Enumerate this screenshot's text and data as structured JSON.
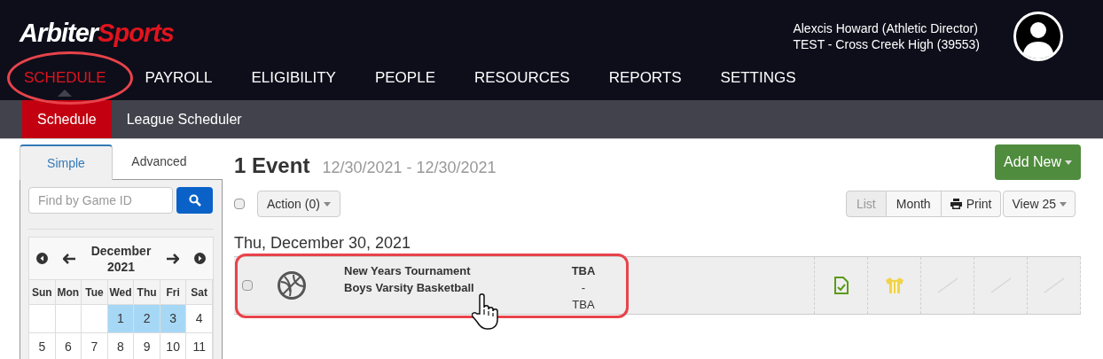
{
  "logo": {
    "first": "Arbiter",
    "second": "Sports"
  },
  "user": {
    "name": "Alexcis Howard (Athletic Director)",
    "org": "TEST - Cross Creek High (39553)"
  },
  "nav": [
    {
      "label": "SCHEDULE",
      "selected": true
    },
    {
      "label": "PAYROLL",
      "selected": false
    },
    {
      "label": "ELIGIBILITY",
      "selected": false
    },
    {
      "label": "PEOPLE",
      "selected": false
    },
    {
      "label": "RESOURCES",
      "selected": false
    },
    {
      "label": "REPORTS",
      "selected": false
    },
    {
      "label": "SETTINGS",
      "selected": false
    }
  ],
  "subnav": [
    {
      "label": "Schedule",
      "selected": true
    },
    {
      "label": "League Scheduler",
      "selected": false
    }
  ],
  "sidebar": {
    "tabs": [
      {
        "label": "Simple",
        "selected": true
      },
      {
        "label": "Advanced",
        "selected": false
      }
    ],
    "search": {
      "placeholder": "Find by Game ID"
    },
    "calendar": {
      "month": "December",
      "year": "2021",
      "weekdays": [
        "Sun",
        "Mon",
        "Tue",
        "Wed",
        "Thu",
        "Fri",
        "Sat"
      ],
      "weeks": [
        [
          {
            "kind": "blank"
          },
          {
            "kind": "blank"
          },
          {
            "kind": "blank"
          },
          {
            "kind": "day",
            "day": "1",
            "selected": true
          },
          {
            "kind": "day",
            "day": "2",
            "selected": true
          },
          {
            "kind": "day",
            "day": "3",
            "selected": true
          },
          {
            "kind": "day",
            "day": "4",
            "selected": false
          }
        ],
        [
          {
            "kind": "day",
            "day": "5",
            "selected": false
          },
          {
            "kind": "day",
            "day": "6",
            "selected": false
          },
          {
            "kind": "day",
            "day": "7",
            "selected": false
          },
          {
            "kind": "day",
            "day": "8",
            "selected": false
          },
          {
            "kind": "day",
            "day": "9",
            "selected": false
          },
          {
            "kind": "day",
            "day": "10",
            "selected": false
          },
          {
            "kind": "day",
            "day": "11",
            "selected": false
          }
        ]
      ]
    }
  },
  "main": {
    "count": "1 Event",
    "range": "12/30/2021 - 12/30/2021",
    "add_button": "Add New",
    "select_all": {
      "checked": false
    },
    "action_button": "Action (0)",
    "views": [
      {
        "label": "List",
        "selected": true
      },
      {
        "label": "Month",
        "selected": false
      }
    ],
    "print_button": "Print",
    "page_size": "View 25",
    "groups": [
      {
        "date": "Thu, December 30, 2021",
        "events": [
          {
            "checked": false,
            "title": "New Years Tournament",
            "subtitle": "Boys Varsity Basketball",
            "site_top": "TBA",
            "site_sep": "-",
            "site_bottom": "TBA",
            "slots": [
              {
                "kind": "document"
              },
              {
                "kind": "jersey"
              },
              {
                "kind": "empty"
              },
              {
                "kind": "empty"
              },
              {
                "kind": "empty"
              }
            ]
          }
        ]
      }
    ]
  }
}
